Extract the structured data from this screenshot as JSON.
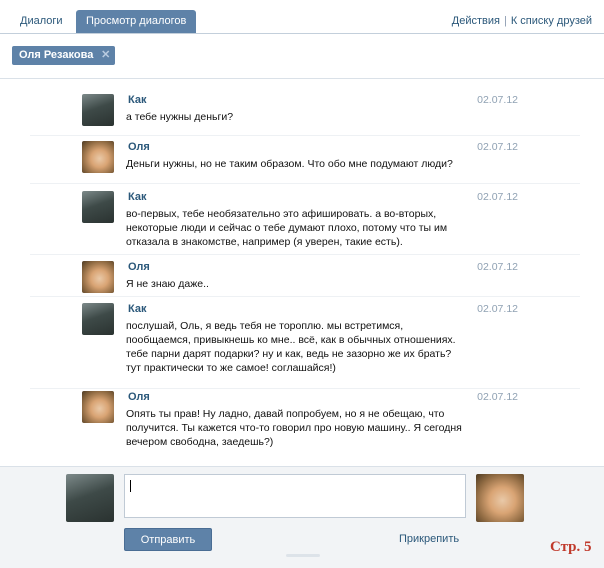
{
  "tabs": [
    {
      "label": "Диалоги"
    },
    {
      "label": "Просмотр диалогов"
    }
  ],
  "toplinks": {
    "actions": "Действия",
    "separator": "|",
    "friends": "К списку друзей"
  },
  "filter": {
    "chip": "Оля Резакова"
  },
  "messages": [
    {
      "author": "Как",
      "date": "02.07.12",
      "text": "а тебе нужны деньги?"
    },
    {
      "author": "Оля",
      "date": "02.07.12",
      "text": "Деньги нужны, но не таким образом. Что обо мне подумают люди?"
    },
    {
      "author": "Как",
      "date": "02.07.12",
      "text": "во-первых, тебе необязательно это афишировать. а во-вторых, некоторые люди и сейчас о тебе думают плохо, потому что ты им отказала в знакомстве, например (я уверен, такие есть)."
    },
    {
      "author": "Оля",
      "date": "02.07.12",
      "text": "Я не знаю даже.."
    },
    {
      "author": "Как",
      "date": "02.07.12",
      "text": "послушай, Оль, я ведь тебя не тороплю. мы встретимся, пообщаемся, привыкнешь ко мне.. всё, как в обычных отношениях. тебе парни дарят подарки? ну и как, ведь не зазорно же их брать? тут практически то же самое! соглашайся!)"
    },
    {
      "author": "Оля",
      "date": "02.07.12",
      "text": "Опять ты прав! Ну ладно, давай попробуем, но я не обещаю, что получится. Ты кажется что-то говорил про новую машину.. Я сегодня вечером свободна, заедешь?)"
    }
  ],
  "composer": {
    "send_label": "Отправить",
    "attach_label": "Прикрепить"
  },
  "page_label": "Стр. 5"
}
